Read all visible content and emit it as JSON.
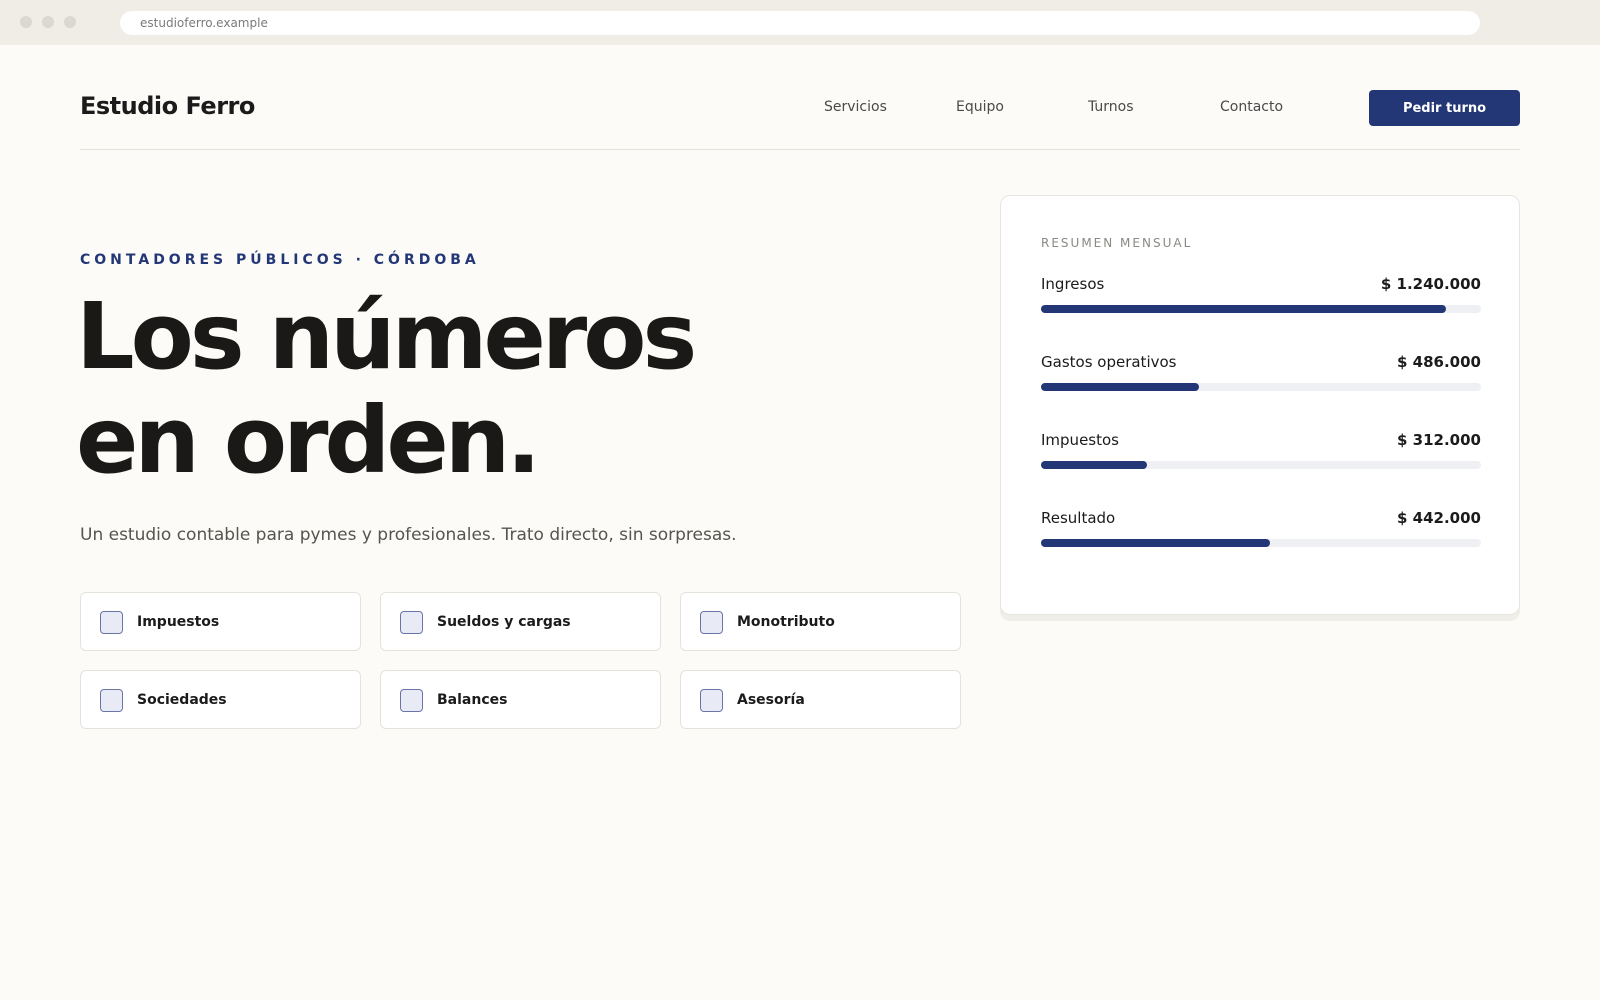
{
  "browser": {
    "url": "estudioferro.example"
  },
  "header": {
    "logo": "Estudio Ferro",
    "nav": [
      "Servicios",
      "Equipo",
      "Turnos",
      "Contacto"
    ],
    "cta_label": "Pedir turno"
  },
  "hero": {
    "kicker": "CONTADORES PÚBLICOS · CÓRDOBA",
    "title_line1": "Los números",
    "title_line2": "en orden.",
    "subtitle": "Un estudio contable para pymes y profesionales. Trato directo, sin sorpresas."
  },
  "services": [
    {
      "label": "Impuestos"
    },
    {
      "label": "Sueldos y cargas"
    },
    {
      "label": "Monotributo"
    },
    {
      "label": "Sociedades"
    },
    {
      "label": "Balances"
    },
    {
      "label": "Asesoría"
    }
  ],
  "summary": {
    "title": "RESUMEN MENSUAL",
    "rows": [
      {
        "label": "Ingresos",
        "value": "$ 1.240.000",
        "fraction": 0.92
      },
      {
        "label": "Gastos operativos",
        "value": "$ 486.000",
        "fraction": 0.36
      },
      {
        "label": "Impuestos",
        "value": "$ 312.000",
        "fraction": 0.24
      },
      {
        "label": "Resultado",
        "value": "$ 442.000",
        "fraction": 0.52
      }
    ]
  },
  "colors": {
    "accent": "#233777",
    "background": "#fcfbf8",
    "chrome": "#efede6"
  }
}
